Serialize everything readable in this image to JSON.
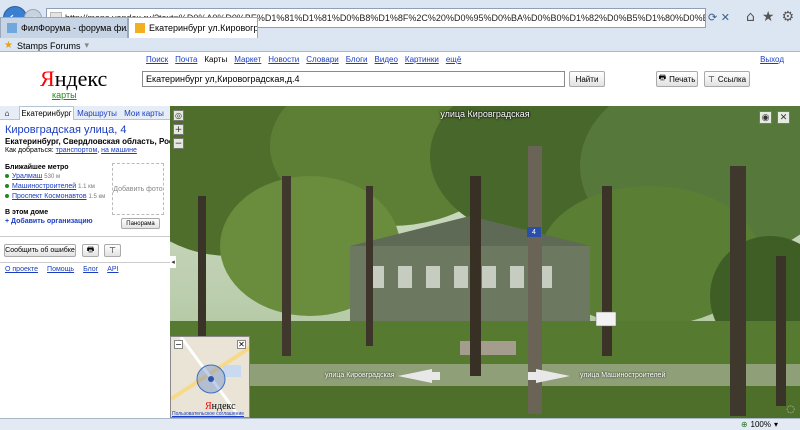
{
  "browser": {
    "url": "http://maps.yandex.ru/?text=%D0%A0%D0%BE%D1%81%D1%81%D0%B8%D1%8F%2C%20%D0%95%D0%BA%D0%B0%D1%82%D0%B5%D1%80%D0%B8%D0%BD%D0%B1%D1%83%D1%80%D0%B3%2C%20%D1%83%D0%BB%D0%B8%D1%86%D0%B0%20%D0%9A%D0%B8%D1%80%D0%BE%D0%B2%D0%BE%D0%B3%D1%80%D0%B0%D0%B4%D1%81%D0%BA%D0%B0%D1%8F",
    "tabs": [
      {
        "label": "ФилФорума - форума филател..."
      },
      {
        "label": "Екатеринбург ул.Кировогра..."
      }
    ],
    "favorite_label": "Stamps Forums",
    "zoom_label": "100%",
    "accent": "#3a7fd0"
  },
  "header": {
    "nav": [
      "Поиск",
      "Почта",
      "Карты",
      "Маркет",
      "Новости",
      "Словари",
      "Блоги",
      "Видео",
      "Картинки",
      "ещё"
    ],
    "exit": "Выход",
    "logo_first": "Я",
    "logo_rest": "ндекс",
    "logo_sub": "карты",
    "search_value": "Екатеринбург ул,Кировоградская,д.4",
    "find_label": "Найти",
    "print_label": "Печать",
    "link_label": "Ссылка"
  },
  "sidebar": {
    "tabs": {
      "city": "Екатеринбург",
      "routes": "Маршруты",
      "mymaps": "Мои карты"
    },
    "title": "Кировградская улица, 4",
    "region": "Екатеринбург, Свердловская область, Россия",
    "howto_prefix": "Как добраться:",
    "howto_transport": "транспортом",
    "howto_car": "на машине",
    "metro_heading": "Ближайшее метро",
    "metro": [
      {
        "name": "Уралмаш",
        "dist": "530 м"
      },
      {
        "name": "Машиностроителей",
        "dist": "1.1 км"
      },
      {
        "name": "Проспект Космонавтов",
        "dist": "1.5 км"
      }
    ],
    "add_photo": "Добавить фото",
    "in_house": "В этом доме",
    "add_org": "+ Добавить организацию",
    "panorama": "Панорама",
    "report_error": "Сообщить об ошибке",
    "footer": [
      "О проекте",
      "Помощь",
      "Блог",
      "API"
    ]
  },
  "panorama": {
    "street_title": "улица Кировградская",
    "road_left": "улица Кировградская",
    "road_right": "улица Машиностроителей",
    "house_number": "4"
  },
  "minimap": {
    "logo_first": "Я",
    "logo_rest": "ндекс",
    "copyright": "Пользовательское соглашение"
  }
}
